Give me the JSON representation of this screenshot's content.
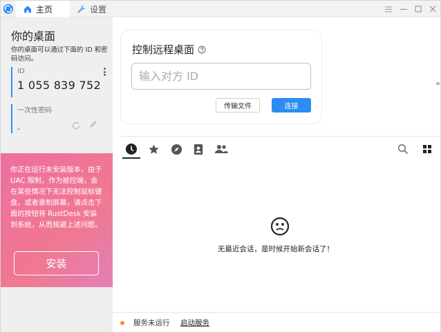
{
  "titlebar": {
    "tabs": [
      {
        "label": "主页",
        "icon": "home-icon",
        "active": true
      },
      {
        "label": "设置",
        "icon": "wrench-icon",
        "active": false
      }
    ],
    "controls": [
      "menu-icon",
      "minimize-icon",
      "maximize-icon",
      "close-icon"
    ]
  },
  "left": {
    "title": "你的桌面",
    "description": "你的桌面可以通过下面的 ID 和密码访问。",
    "id_label": "ID",
    "id_value": "1 055 839 752",
    "password_label": "一次性密码",
    "password_value": "-",
    "warning_text": "你正在运行未安装版本，由于 UAC 限制，作为被控端，会在某些情况下无法控制鼠标键盘，或者录制屏幕，请点击下面的按钮将 RustDesk 安装到系统，从而规避上述问题。",
    "install_label": "安装"
  },
  "remote": {
    "title": "控制远程桌面",
    "input_placeholder": "输入对方 ID",
    "transfer_label": "传输文件",
    "connect_label": "连接"
  },
  "sessions": {
    "tabs": [
      "recent-sessions-icon",
      "favorites-icon",
      "discovered-icon",
      "address-book-icon",
      "group-icon"
    ],
    "active_tab": "recent-sessions-icon",
    "empty_text": "无最近会话，是时候开始新会话了！"
  },
  "status": {
    "text": "服务未运行",
    "start_link": "启动服务",
    "dot_color": "#f0894a"
  },
  "colors": {
    "accent": "#2c8cf4",
    "warning_gradient_start": "#ee6fa0",
    "warning_gradient_end": "#e27fb6"
  }
}
